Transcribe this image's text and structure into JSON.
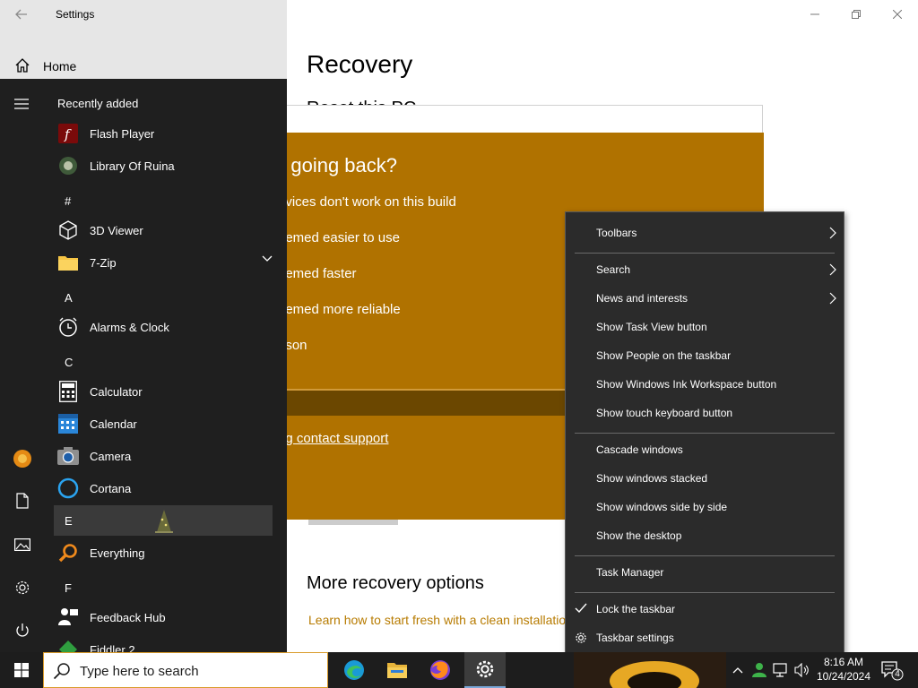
{
  "settings": {
    "title": "Settings",
    "home_label": "Home",
    "page_title": "Recovery",
    "reset_heading": "Reset this PC",
    "more_recovery_heading": "More recovery options",
    "learn_link": "Learn how to start fresh with a clean installation of Windows"
  },
  "dialog": {
    "heading": "u going back?",
    "options": [
      "evices don't work on this build",
      "eemed easier to use",
      "eemed faster",
      "eemed more reliable",
      "ason"
    ],
    "support_link": "ng contact support",
    "background_color": "#b07200"
  },
  "start_menu": {
    "recently_added": "Recently added",
    "apps": [
      {
        "label": "Flash Player",
        "icon": "flash-player-icon"
      },
      {
        "label": "Library Of Ruina",
        "icon": "library-of-ruina-icon"
      },
      {
        "label": "3D Viewer",
        "icon": "3d-viewer-icon"
      },
      {
        "label": "7-Zip",
        "icon": "folder-icon"
      },
      {
        "label": "Alarms & Clock",
        "icon": "alarm-clock-icon"
      },
      {
        "label": "Calculator",
        "icon": "calculator-icon"
      },
      {
        "label": "Calendar",
        "icon": "calendar-icon"
      },
      {
        "label": "Camera",
        "icon": "camera-icon"
      },
      {
        "label": "Cortana",
        "icon": "cortana-icon"
      },
      {
        "label": "Everything",
        "icon": "everything-search-icon"
      },
      {
        "label": "Feedback Hub",
        "icon": "feedback-hub-icon"
      },
      {
        "label": "Fiddler 2",
        "icon": "fiddler-icon"
      }
    ],
    "groups": [
      "#",
      "A",
      "C",
      "E",
      "F"
    ]
  },
  "context_menu": {
    "items": [
      {
        "label": "Toolbars",
        "submenu": true
      },
      {
        "label": "Search",
        "submenu": true
      },
      {
        "label": "News and interests",
        "submenu": true
      },
      {
        "label": "Show Task View button"
      },
      {
        "label": "Show People on the taskbar"
      },
      {
        "label": "Show Windows Ink Workspace button"
      },
      {
        "label": "Show touch keyboard button"
      },
      {
        "label": "Cascade windows"
      },
      {
        "label": "Show windows stacked"
      },
      {
        "label": "Show windows side by side"
      },
      {
        "label": "Show the desktop"
      },
      {
        "label": "Task Manager"
      },
      {
        "label": "Lock the taskbar",
        "checked": true
      },
      {
        "label": "Taskbar settings",
        "icon": "gear-icon"
      }
    ]
  },
  "taskbar": {
    "search_placeholder": "Type here to search",
    "time": "8:16 AM",
    "date": "10/24/2024",
    "notification_count": "4",
    "pinned": [
      "edge-icon",
      "file-explorer-icon",
      "firefox-icon",
      "settings-gear-icon"
    ]
  },
  "colors": {
    "accent": "#b07200",
    "start_bg": "#1f1f1f",
    "menu_bg": "#2b2b2b",
    "taskbar_bg": "#1d1d1d"
  }
}
